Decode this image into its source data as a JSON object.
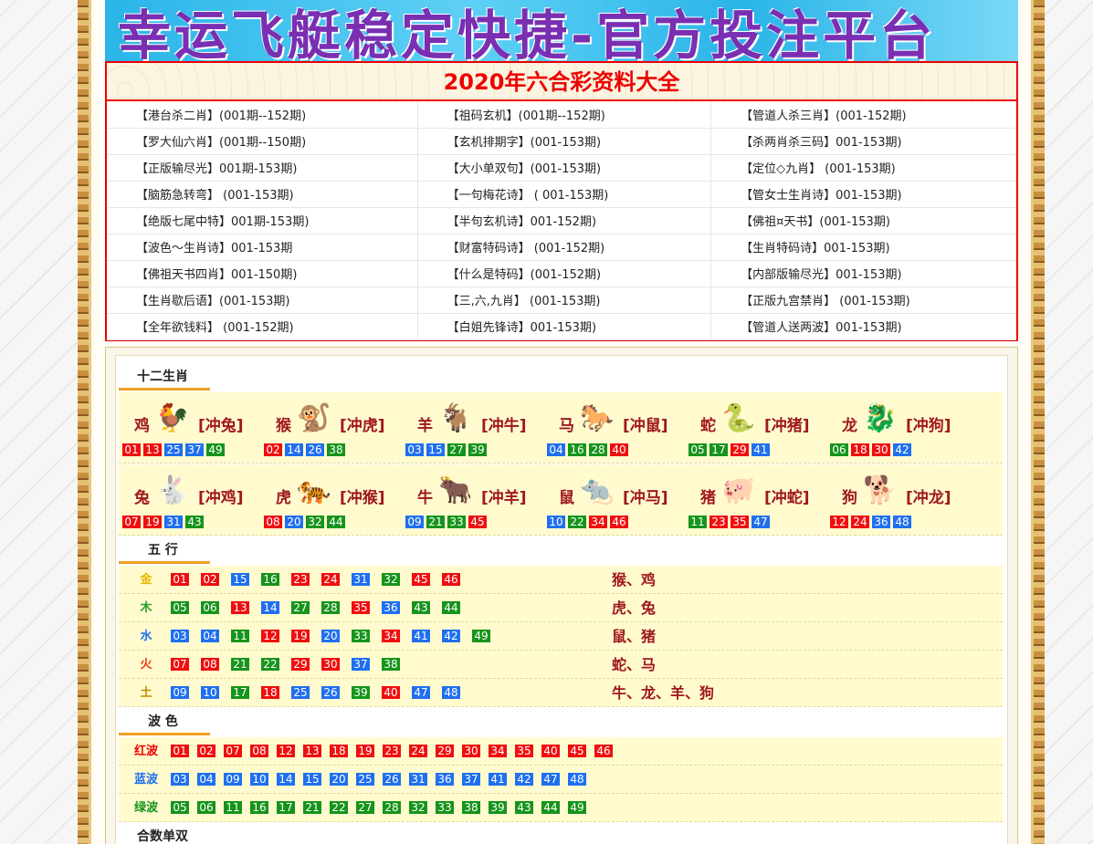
{
  "banner": {
    "text": "幸运飞艇稳定快捷-官方投注平台"
  },
  "ziliao": {
    "title": "2020年六合彩资料大全",
    "rows": [
      [
        "【港台杀二肖】(001期--152期)",
        "【祖码玄机】(001期--152期)",
        "【管道人杀三肖】(001-152期)"
      ],
      [
        "【罗大仙六肖】(001期--150期)",
        "【玄机排期字】(001-153期)",
        "【杀两肖杀三码】001-153期)"
      ],
      [
        "【正版输尽光】001期-153期)",
        "【大小单双句】(001-153期)",
        "【定位◇九肖】 (001-153期)"
      ],
      [
        "【脑筋急转弯】 (001-153期)",
        "【一句梅花诗】 ( 001-153期)",
        "【管女士生肖诗】001-153期)"
      ],
      [
        "【绝版七尾中特】001期-153期)",
        "【半句玄机诗】001-152期)",
        "【佛祖¤天书】(001-153期)"
      ],
      [
        "【波色～生肖诗】001-153期",
        "【财富特码诗】 (001-152期)",
        "【生肖特码诗】001-153期)"
      ],
      [
        "【佛祖天书四肖】001-150期)",
        "【什么是特码】(001-152期)",
        "【内部版输尽光】001-153期)"
      ],
      [
        "【生肖歇后语】(001-153期)",
        "【三,六,九肖】 (001-153期)",
        "【正版九宫禁肖】 (001-153期)"
      ],
      [
        "【全年欲钱料】 (001-152期)",
        "【白姐先锋诗】001-153期)",
        "【管道人送两波】001-153期)"
      ]
    ]
  },
  "zodiac": {
    "title": "十二生肖",
    "row1": [
      {
        "name": "鸡",
        "chong": "[冲兔]",
        "icon": "rooster-icon",
        "glyph": "🐓",
        "balls": [
          [
            "01",
            "red"
          ],
          [
            "13",
            "red"
          ],
          [
            "25",
            "blue"
          ],
          [
            "37",
            "blue"
          ],
          [
            "49",
            "green"
          ]
        ]
      },
      {
        "name": "猴",
        "chong": "[冲虎]",
        "icon": "monkey-icon",
        "glyph": "🐒",
        "balls": [
          [
            "02",
            "red"
          ],
          [
            "14",
            "blue"
          ],
          [
            "26",
            "blue"
          ],
          [
            "38",
            "green"
          ]
        ]
      },
      {
        "name": "羊",
        "chong": "[冲牛]",
        "icon": "goat-icon",
        "glyph": "🐐",
        "balls": [
          [
            "03",
            "blue"
          ],
          [
            "15",
            "blue"
          ],
          [
            "27",
            "green"
          ],
          [
            "39",
            "green"
          ]
        ]
      },
      {
        "name": "马",
        "chong": "[冲鼠]",
        "icon": "horse-icon",
        "glyph": "🐎",
        "balls": [
          [
            "04",
            "blue"
          ],
          [
            "16",
            "green"
          ],
          [
            "28",
            "green"
          ],
          [
            "40",
            "red"
          ]
        ]
      },
      {
        "name": "蛇",
        "chong": "[冲猪]",
        "icon": "snake-icon",
        "glyph": "🐍",
        "balls": [
          [
            "05",
            "green"
          ],
          [
            "17",
            "green"
          ],
          [
            "29",
            "red"
          ],
          [
            "41",
            "blue"
          ]
        ]
      },
      {
        "name": "龙",
        "chong": "[冲狗]",
        "icon": "dragon-icon",
        "glyph": "🐉",
        "balls": [
          [
            "06",
            "green"
          ],
          [
            "18",
            "red"
          ],
          [
            "30",
            "red"
          ],
          [
            "42",
            "blue"
          ]
        ]
      }
    ],
    "row2": [
      {
        "name": "兔",
        "chong": "[冲鸡]",
        "icon": "rabbit-icon",
        "glyph": "🐇",
        "balls": [
          [
            "07",
            "red"
          ],
          [
            "19",
            "red"
          ],
          [
            "31",
            "blue"
          ],
          [
            "43",
            "green"
          ]
        ]
      },
      {
        "name": "虎",
        "chong": "[冲猴]",
        "icon": "tiger-icon",
        "glyph": "🐅",
        "balls": [
          [
            "08",
            "red"
          ],
          [
            "20",
            "blue"
          ],
          [
            "32",
            "green"
          ],
          [
            "44",
            "green"
          ]
        ]
      },
      {
        "name": "牛",
        "chong": "[冲羊]",
        "icon": "ox-icon",
        "glyph": "🐂",
        "balls": [
          [
            "09",
            "blue"
          ],
          [
            "21",
            "green"
          ],
          [
            "33",
            "green"
          ],
          [
            "45",
            "red"
          ]
        ]
      },
      {
        "name": "鼠",
        "chong": "[冲马]",
        "icon": "rat-icon",
        "glyph": "🐀",
        "balls": [
          [
            "10",
            "blue"
          ],
          [
            "22",
            "green"
          ],
          [
            "34",
            "red"
          ],
          [
            "46",
            "red"
          ]
        ]
      },
      {
        "name": "猪",
        "chong": "[冲蛇]",
        "icon": "pig-icon",
        "glyph": "🐖",
        "balls": [
          [
            "11",
            "green"
          ],
          [
            "23",
            "red"
          ],
          [
            "35",
            "red"
          ],
          [
            "47",
            "blue"
          ]
        ]
      },
      {
        "name": "狗",
        "chong": "[冲龙]",
        "icon": "dog-icon",
        "glyph": "🐕",
        "balls": [
          [
            "12",
            "red"
          ],
          [
            "24",
            "red"
          ],
          [
            "36",
            "blue"
          ],
          [
            "48",
            "blue"
          ]
        ]
      }
    ]
  },
  "wuxing": {
    "title": "五 行",
    "rows": [
      {
        "label": "金",
        "color": "#e8b800",
        "balls": [
          [
            "01",
            "red"
          ],
          [
            "02",
            "red"
          ],
          [
            "15",
            "blue"
          ],
          [
            "16",
            "green"
          ],
          [
            "23",
            "red"
          ],
          [
            "24",
            "red"
          ],
          [
            "31",
            "blue"
          ],
          [
            "32",
            "green"
          ],
          [
            "45",
            "red"
          ],
          [
            "46",
            "red"
          ]
        ],
        "animals": "猴、鸡"
      },
      {
        "label": "木",
        "color": "#2aa02a",
        "balls": [
          [
            "05",
            "green"
          ],
          [
            "06",
            "green"
          ],
          [
            "13",
            "red"
          ],
          [
            "14",
            "blue"
          ],
          [
            "27",
            "green"
          ],
          [
            "28",
            "green"
          ],
          [
            "35",
            "red"
          ],
          [
            "36",
            "blue"
          ],
          [
            "43",
            "green"
          ],
          [
            "44",
            "green"
          ]
        ],
        "animals": "虎、兔"
      },
      {
        "label": "水",
        "color": "#1f6ff0",
        "balls": [
          [
            "03",
            "blue"
          ],
          [
            "04",
            "blue"
          ],
          [
            "11",
            "green"
          ],
          [
            "12",
            "red"
          ],
          [
            "19",
            "red"
          ],
          [
            "20",
            "blue"
          ],
          [
            "33",
            "green"
          ],
          [
            "34",
            "red"
          ],
          [
            "41",
            "blue"
          ],
          [
            "42",
            "blue"
          ],
          [
            "49",
            "green"
          ]
        ],
        "animals": "鼠、猪"
      },
      {
        "label": "火",
        "color": "#f03a10",
        "balls": [
          [
            "07",
            "red"
          ],
          [
            "08",
            "red"
          ],
          [
            "21",
            "green"
          ],
          [
            "22",
            "green"
          ],
          [
            "29",
            "red"
          ],
          [
            "30",
            "red"
          ],
          [
            "37",
            "blue"
          ],
          [
            "38",
            "green"
          ]
        ],
        "animals": "蛇、马"
      },
      {
        "label": "土",
        "color": "#c09000",
        "balls": [
          [
            "09",
            "blue"
          ],
          [
            "10",
            "blue"
          ],
          [
            "17",
            "green"
          ],
          [
            "18",
            "red"
          ],
          [
            "25",
            "blue"
          ],
          [
            "26",
            "blue"
          ],
          [
            "39",
            "green"
          ],
          [
            "40",
            "red"
          ],
          [
            "47",
            "blue"
          ],
          [
            "48",
            "blue"
          ]
        ],
        "animals": "牛、龙、羊、狗"
      }
    ]
  },
  "bose": {
    "title": "波 色",
    "rows": [
      {
        "label": "红波",
        "color": "#e00",
        "cls": "red",
        "nums": [
          "01",
          "02",
          "07",
          "08",
          "12",
          "13",
          "18",
          "19",
          "23",
          "24",
          "29",
          "30",
          "34",
          "35",
          "40",
          "45",
          "46"
        ]
      },
      {
        "label": "蓝波",
        "color": "#1f6ff0",
        "cls": "blue",
        "nums": [
          "03",
          "04",
          "09",
          "10",
          "14",
          "15",
          "20",
          "25",
          "26",
          "31",
          "36",
          "37",
          "41",
          "42",
          "47",
          "48"
        ]
      },
      {
        "label": "绿波",
        "color": "#16941b",
        "cls": "green",
        "nums": [
          "05",
          "06",
          "11",
          "16",
          "17",
          "21",
          "22",
          "27",
          "28",
          "32",
          "33",
          "38",
          "39",
          "43",
          "44",
          "49"
        ]
      }
    ]
  },
  "heshu": {
    "title": "合数单双"
  }
}
